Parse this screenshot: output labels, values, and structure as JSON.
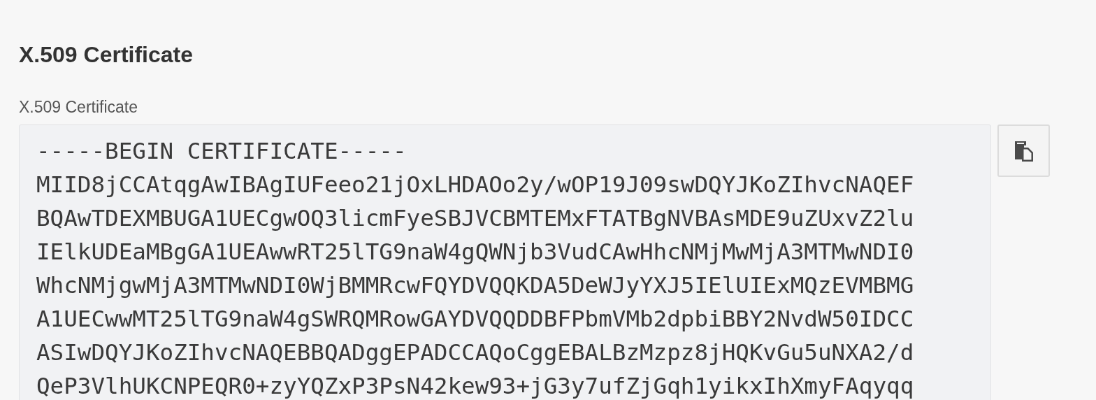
{
  "heading": "X.509 Certificate",
  "field": {
    "label": "X.509 Certificate",
    "lines": [
      "-----BEGIN CERTIFICATE-----",
      "MIID8jCCAtqgAwIBAgIUFeeo21jOxLHDAOo2y/wOP19J09swDQYJKoZIhvcNAQEF",
      "BQAwTDEXMBUGA1UECgwOQ3licmFyeSBJVCBMTEMxFTATBgNVBAsMDE9uZUxvZ2lu",
      "IElkUDEaMBgGA1UEAwwRT25lTG9naW4gQWNjb3VudCAwHhcNMjMwMjA3MTMwNDI0",
      "WhcNMjgwMjA3MTMwNDI0WjBMMRcwFQYDVQQKDA5DeWJyYXJ5IElUIExMQzEVMBMG",
      "A1UECwwMT25lTG9naW4gSWRQMRowGAYDVQQDDBFPbmVMb2dpbiBBY2NvdW50IDCC",
      "ASIwDQYJKoZIhvcNAQEBBQADggEPADCCAQoCggEBALBzMzpz8jHQKvGu5uNXA2/d",
      "QeP3VlhUKCNPEQR0+zyYQZxP3PsN42kew93+jG3y7ufZjGqh1yikxIhXmyFAqyqq"
    ]
  },
  "copy_button": {
    "kind": "copy"
  }
}
